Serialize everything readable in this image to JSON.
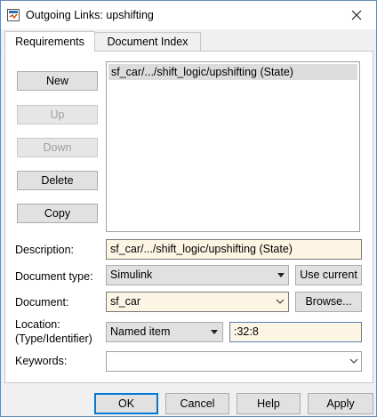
{
  "window": {
    "title": "Outgoing Links: upshifting"
  },
  "tabs": [
    "Requirements",
    "Document Index"
  ],
  "side_buttons": {
    "new": "New",
    "up": "Up",
    "down": "Down",
    "delete": "Delete",
    "copy": "Copy"
  },
  "list": {
    "items": [
      "sf_car/.../shift_logic/upshifting (State)"
    ]
  },
  "form": {
    "description_label": "Description:",
    "description_value": "sf_car/.../shift_logic/upshifting (State)",
    "doctype_label": "Document type:",
    "doctype_value": "Simulink",
    "use_current": "Use current",
    "document_label": "Document:",
    "document_value": "sf_car",
    "browse": "Browse...",
    "location_label_1": "Location:",
    "location_label_2": "(Type/Identifier)",
    "location_type": "Named item",
    "location_id": ":32:8",
    "keywords_label": "Keywords:",
    "keywords_value": ""
  },
  "footer": {
    "ok": "OK",
    "cancel": "Cancel",
    "help": "Help",
    "apply": "Apply"
  },
  "icons": {
    "title": "simulink-app-icon",
    "close": "close-icon"
  }
}
